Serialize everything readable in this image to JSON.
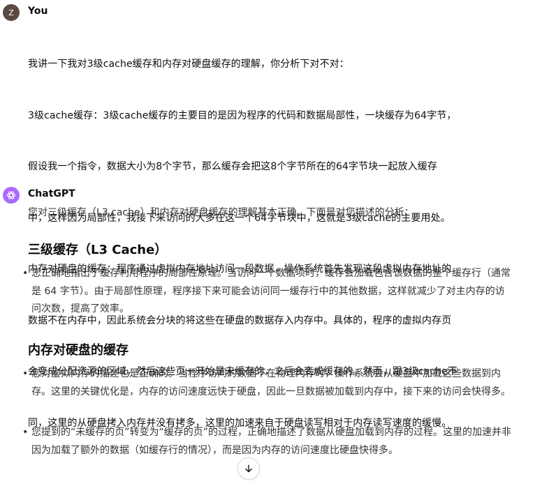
{
  "user": {
    "avatar_letter": "Z",
    "name": "You",
    "lines": [
      "我讲一下我对3级cache缓存和内存对硬盘缓存的理解，你分析下对不对：",
      "3级cache缓存：3级cache缓存的主要目的是因为程序的代码和数据局部性，一块缓存为64字节，",
      "假设我一个指令，数据大小为8个字节，那么缓存会把这8个字节所在的64字节块一起放入缓存",
      "中，这样因为局部性，我接下来访问的大多在这一个64字节块中，这就是3级cache的主要用处。",
      "内存对硬盘的缓存：程序通过虚拟内存地址访问一段数据，操作系统首先发现这段虚拟内存地址的",
      "数据不在内存中，因此系统会分块的将这些在硬盘的数据存入内存中。具体的，程序的虚拟内存页",
      "会变成分配资源的区域，然后这些页一开始是未缓存的，之后会变成缓存的。然而，跟3级cache不",
      "同，这里的从硬盘拷入内存并没有拷多，这里的加速来自于硬盘读写相对于内存读写速度的缓慢。"
    ]
  },
  "assistant": {
    "name": "ChatGPT",
    "intro": "您对三级缓存（L3 cache）和内存对硬盘缓存的理解基本正确。下面是对您描述的分析：",
    "sections": [
      {
        "heading": "三级缓存（L3 Cache）",
        "bullets": [
          "您正确地指出了缓存利用程序的局部性原理。当访问一个数据项时，缓存会加载包含该数据的整个缓存行（通常是 64 字节）。由于局部性原理，程序接下来可能会访问同一缓存行中的其他数据，这样就减少了对主内存的访问次数，提高了效率。"
        ]
      },
      {
        "heading": "内存对硬盘的缓存",
        "bullets": [
          "您对虚拟内存的描述也是正确的。当程序访问的数据不在物理内存时，操作系统会从硬盘中加载这些数据到内存。这里的关键优化是，内存的访问速度远快于硬盘，因此一旦数据被加载到内存中，接下来的访问会快得多。",
          "您提到的“未缓存的页”转变为“缓存的页”的过程，正确地描述了数据从硬盘加载到内存的过程。这里的加速并非因为加载了额外的数据（如缓存行的情况），而是因为内存的访问速度比硬盘快得多。"
        ]
      }
    ]
  },
  "bullet_glyph": "•",
  "icons": {
    "assistant_avatar": "openai-logo-icon",
    "scroll": "arrow-down-icon"
  },
  "colors": {
    "user_avatar": "#5b4a42",
    "assistant_avatar": "#ab68ff"
  }
}
